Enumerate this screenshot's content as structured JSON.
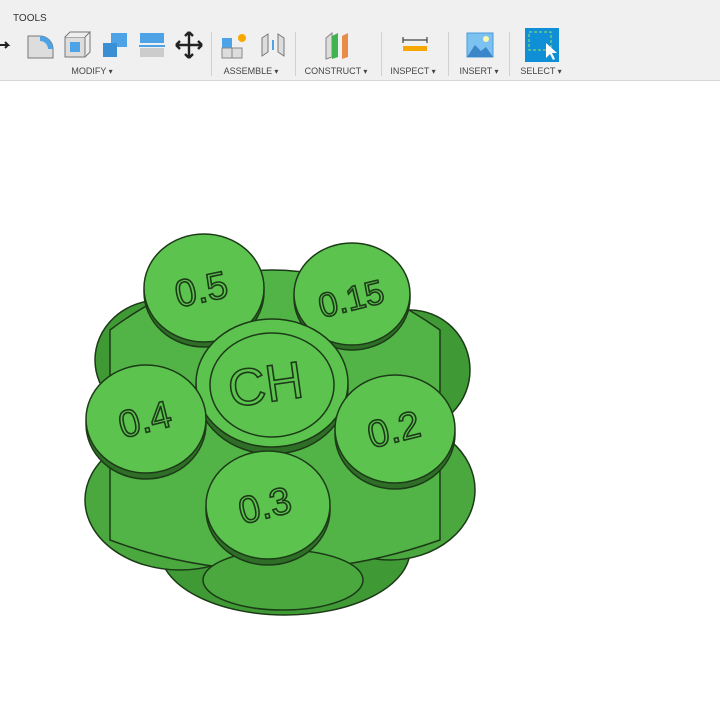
{
  "toolbar": {
    "tools_label": "TOOLS",
    "groups": [
      {
        "label": "MODIFY",
        "icons": [
          "push-pull-icon",
          "fillet-icon",
          "shell-icon",
          "combine-icon",
          "split-face-icon",
          "move-icon"
        ]
      },
      {
        "label": "ASSEMBLE",
        "icons": [
          "new-component-icon",
          "joint-icon"
        ]
      },
      {
        "label": "CONSTRUCT",
        "icons": [
          "offset-plane-icon"
        ]
      },
      {
        "label": "INSPECT",
        "icons": [
          "measure-icon"
        ]
      },
      {
        "label": "INSERT",
        "icons": [
          "insert-image-icon"
        ]
      },
      {
        "label": "SELECT",
        "icons": [
          "select-icon"
        ]
      }
    ]
  },
  "model": {
    "color": "#5cc34f",
    "coins": [
      "0.5",
      "0.15",
      "CH",
      "0.4",
      "0.2",
      "0.3"
    ]
  }
}
